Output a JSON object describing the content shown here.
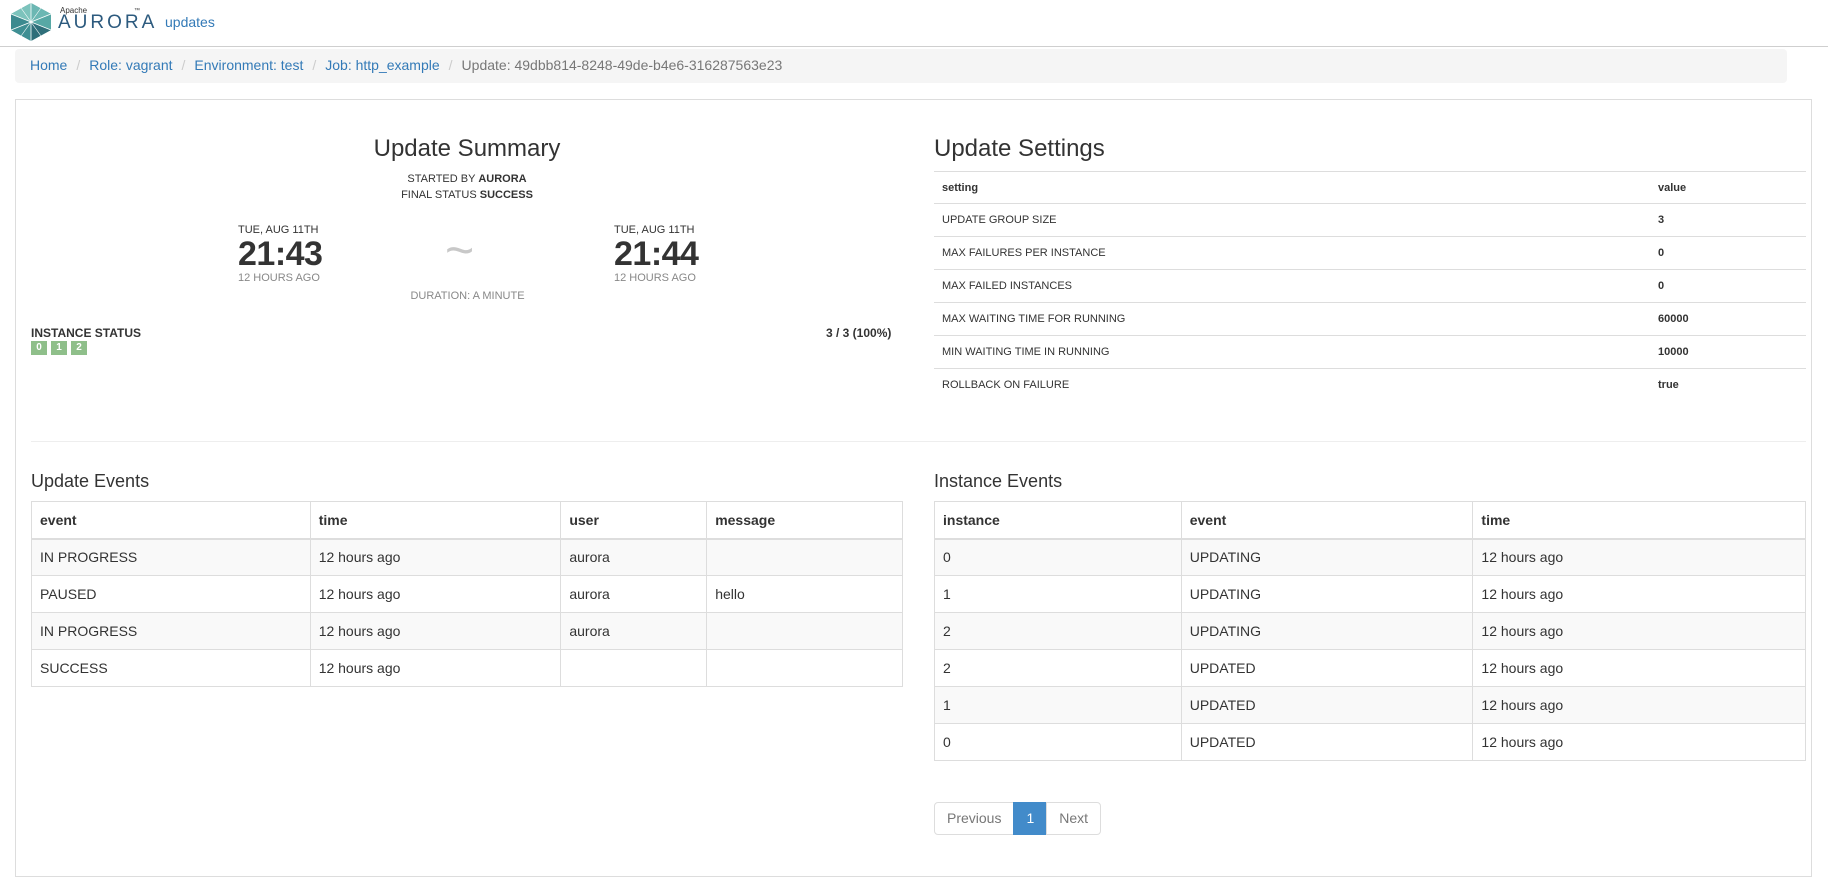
{
  "navbar": {
    "logo_apache": "Apache",
    "logo_text": "AURORA",
    "logo_tm": "™",
    "link": "updates"
  },
  "breadcrumb": {
    "home": "Home",
    "role": "Role: vagrant",
    "environment": "Environment: test",
    "job": "Job: http_example",
    "update": "Update: 49dbb814-8248-49de-b4e6-316287563e23"
  },
  "summary": {
    "title": "Update Summary",
    "started_by_label": "STARTED BY",
    "started_by_value": "AURORA",
    "final_status_label": "FINAL STATUS",
    "final_status_value": "SUCCESS",
    "start": {
      "date": "TUE, AUG 11TH",
      "time": "21:43",
      "ago": "12 HOURS AGO"
    },
    "end": {
      "date": "TUE, AUG 11TH",
      "time": "21:44",
      "ago": "12 HOURS AGO"
    },
    "tilde": "~",
    "duration": "DURATION: A MINUTE",
    "instance_status_label": "INSTANCE STATUS",
    "instance_count": "3 / 3 (100%)",
    "instances": [
      "0",
      "1",
      "2"
    ],
    "instance_color": "#8fbf8a"
  },
  "settings": {
    "title": "Update Settings",
    "headers": [
      "setting",
      "value"
    ],
    "rows": [
      [
        "UPDATE GROUP SIZE",
        "3"
      ],
      [
        "MAX FAILURES PER INSTANCE",
        "0"
      ],
      [
        "MAX FAILED INSTANCES",
        "0"
      ],
      [
        "MAX WAITING TIME FOR RUNNING",
        "60000"
      ],
      [
        "MIN WAITING TIME IN RUNNING",
        "10000"
      ],
      [
        "ROLLBACK ON FAILURE",
        "true"
      ]
    ]
  },
  "update_events": {
    "title": "Update Events",
    "headers": [
      "event",
      "time",
      "user",
      "message"
    ],
    "rows": [
      [
        "IN PROGRESS",
        "12 hours ago",
        "aurora",
        ""
      ],
      [
        "PAUSED",
        "12 hours ago",
        "aurora",
        "hello"
      ],
      [
        "IN PROGRESS",
        "12 hours ago",
        "aurora",
        ""
      ],
      [
        "SUCCESS",
        "12 hours ago",
        "",
        ""
      ]
    ]
  },
  "instance_events": {
    "title": "Instance Events",
    "headers": [
      "instance",
      "event",
      "time"
    ],
    "rows": [
      [
        "0",
        "UPDATING",
        "12 hours ago"
      ],
      [
        "1",
        "UPDATING",
        "12 hours ago"
      ],
      [
        "2",
        "UPDATING",
        "12 hours ago"
      ],
      [
        "2",
        "UPDATED",
        "12 hours ago"
      ],
      [
        "1",
        "UPDATED",
        "12 hours ago"
      ],
      [
        "0",
        "UPDATED",
        "12 hours ago"
      ]
    ]
  },
  "pagination": {
    "previous": "Previous",
    "current": "1",
    "next": "Next"
  }
}
